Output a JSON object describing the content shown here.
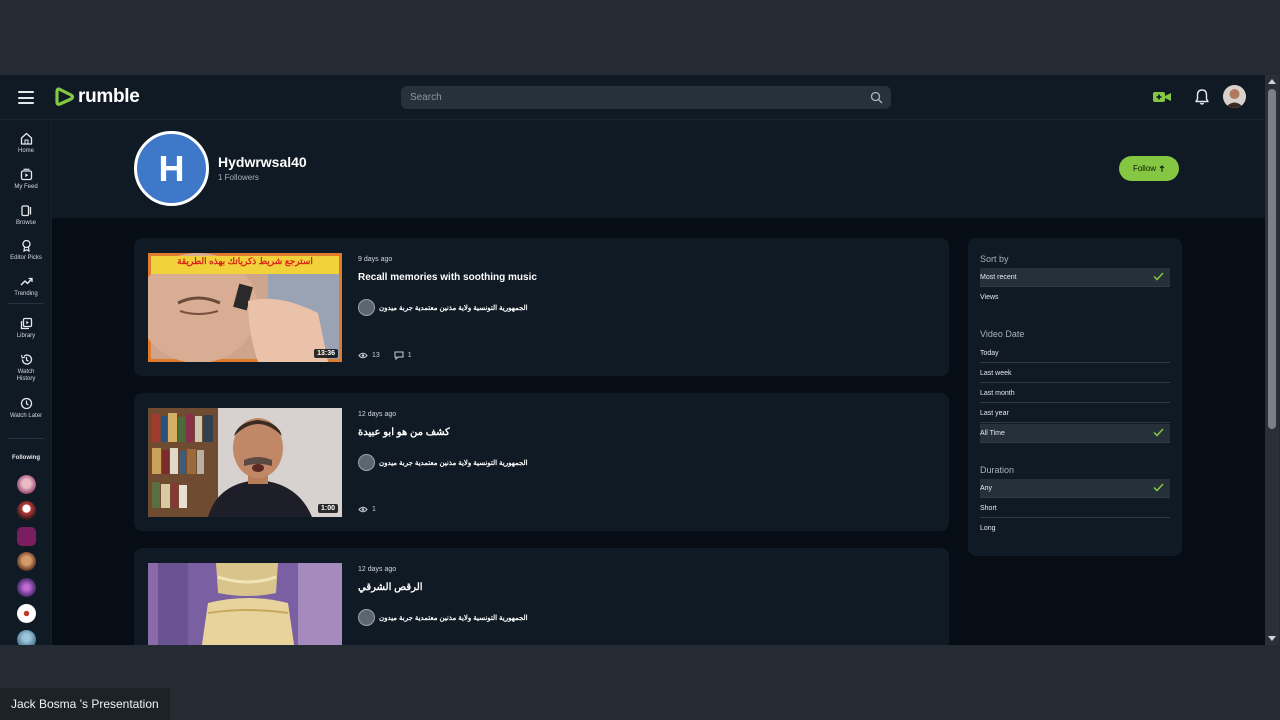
{
  "brand": {
    "name": "rumble",
    "accent": "#85c742"
  },
  "search": {
    "placeholder": "Search"
  },
  "sidebar": {
    "items": [
      {
        "label": "Home",
        "icon": "home-icon"
      },
      {
        "label": "My Feed",
        "icon": "feed-icon"
      },
      {
        "label": "Browse",
        "icon": "browse-icon"
      },
      {
        "label": "Editor Picks",
        "icon": "award-icon"
      },
      {
        "label": "Trending",
        "icon": "trending-icon"
      },
      {
        "label": "Library",
        "icon": "library-icon"
      },
      {
        "label": "Watch History",
        "icon": "history-icon"
      },
      {
        "label": "Watch Later",
        "icon": "clock-icon"
      }
    ],
    "following_label": "Following"
  },
  "channel": {
    "initial": "H",
    "name": "Hydwrwsal40",
    "followers": "1 Followers",
    "follow_label": "Follow"
  },
  "videos": [
    {
      "time_ago": "9 days ago",
      "title": "Recall memories with soothing music",
      "channel": "الجمهورية التونسية ولاية مذنين معتمدية جربة ميدون",
      "duration": "13:36",
      "thumb_caption": "استرجع شريط ذكرياتك بهذه الطريقة",
      "views": "13",
      "comments": "1"
    },
    {
      "time_ago": "12 days ago",
      "title": "كشف من هو ابو عبيدة",
      "channel": "الجمهورية التونسية ولاية مذنين معتمدية جربة ميدون",
      "duration": "1:00",
      "views": "1"
    },
    {
      "time_ago": "12 days ago",
      "title": "الرقص الشرقي",
      "channel": "الجمهورية التونسية ولاية مذنين معتمدية جربة ميدون"
    }
  ],
  "filters": {
    "sort_by": {
      "label": "Sort by",
      "options": [
        "Most recent",
        "Views"
      ],
      "selected": "Most recent"
    },
    "video_date": {
      "label": "Video Date",
      "options": [
        "Today",
        "Last week",
        "Last month",
        "Last year",
        "All Time"
      ],
      "selected": "All Time"
    },
    "duration": {
      "label": "Duration",
      "options": [
        "Any",
        "Short",
        "Long"
      ],
      "selected": "Any"
    }
  },
  "presentation": {
    "label": "Jack Bosma 's Presentation"
  }
}
